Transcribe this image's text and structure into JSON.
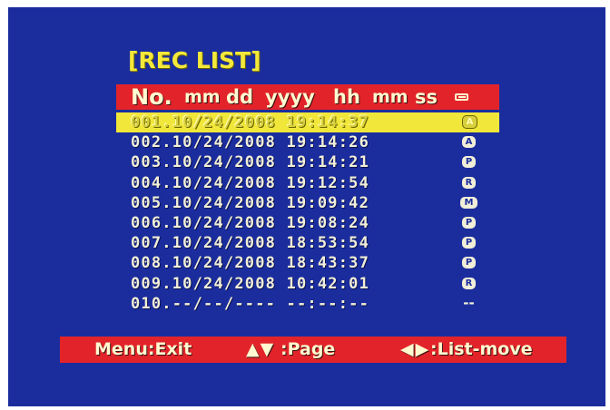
{
  "title": "[REC LIST]",
  "header": {
    "no": "No.",
    "mm1": "mm",
    "dd": "dd",
    "yyyy": "yyyy",
    "hh": "hh",
    "mm2": "mm",
    "ss": "ss",
    "type_icon": "battery-icon"
  },
  "records": [
    {
      "text": "001.10/24/2008 19:14:37",
      "type": "A",
      "selected": true
    },
    {
      "text": "002.10/24/2008 19:14:26",
      "type": "A",
      "selected": false
    },
    {
      "text": "003.10/24/2008 19:14:21",
      "type": "P",
      "selected": false
    },
    {
      "text": "004.10/24/2008 19:12:54",
      "type": "R",
      "selected": false
    },
    {
      "text": "005.10/24/2008 19:09:42",
      "type": "M",
      "selected": false
    },
    {
      "text": "006.10/24/2008 19:08:24",
      "type": "P",
      "selected": false
    },
    {
      "text": "007.10/24/2008 18:53:54",
      "type": "P",
      "selected": false
    },
    {
      "text": "008.10/24/2008 18:43:37",
      "type": "P",
      "selected": false
    },
    {
      "text": "009.10/24/2008 10:42:01",
      "type": "R",
      "selected": false
    },
    {
      "text": "010.--/--/---- --:--:--",
      "type": "--",
      "selected": false
    }
  ],
  "footer": {
    "exit": "Menu:Exit",
    "page_arrows": "▲▼",
    "page": ":Page",
    "move_arrows": "◀▶",
    "move": ":List-move"
  },
  "colors": {
    "background": "#1b2d9d",
    "bar": "#e2242a",
    "selection": "#f1e73a",
    "title": "#f4e93a",
    "text": "#f2efd8"
  }
}
